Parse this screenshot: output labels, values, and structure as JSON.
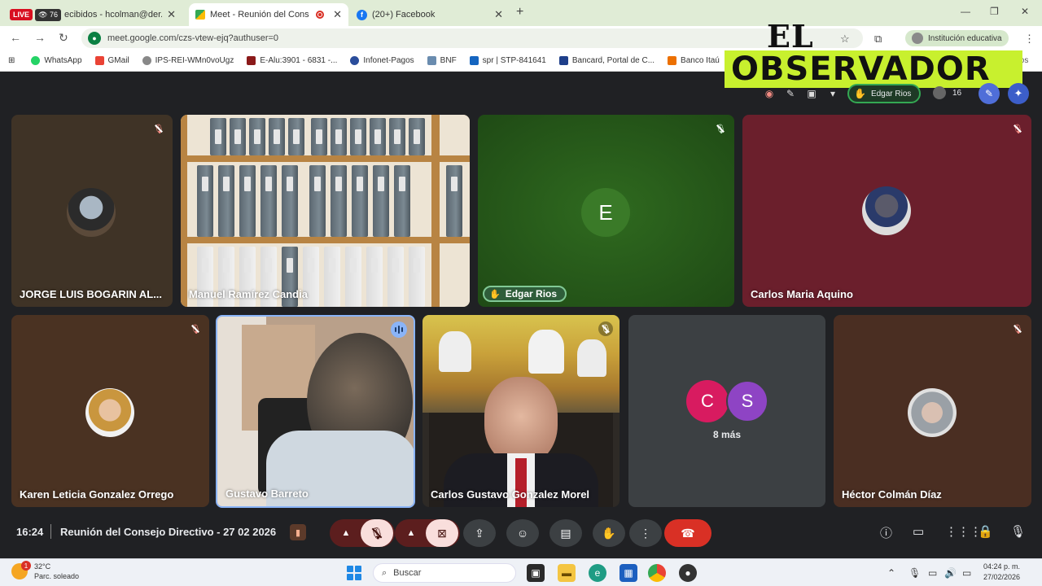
{
  "browser": {
    "tabs": [
      {
        "label": "ecibidos - hcolman@der.una.",
        "live_badge": "LIVE",
        "view_count": "76"
      },
      {
        "label": "Meet - Reunión del Consejo",
        "active": true
      },
      {
        "label": "(20+) Facebook"
      }
    ],
    "url": "meet.google.com/czs-vtew-ejq?authuser=0",
    "profile_label": "Institución educativa",
    "bookmarks": [
      "WhatsApp",
      "GMail",
      "IPS-REI-WMn0voUgz",
      "E-Alu:3901 - 6831 -...",
      "Infonet-Pagos",
      "BNF",
      "spr | STP-841641",
      "Bancard, Portal de C...",
      "Banco Itaú",
      "tos"
    ]
  },
  "logo": {
    "line1": "EL",
    "line2": "OBSERVADOR"
  },
  "meet_top": {
    "speaker_name": "Edgar Rios",
    "participant_count": "16"
  },
  "tiles": [
    {
      "name": "JORGE LUIS BOGARIN AL...",
      "muted": true
    },
    {
      "name": "Manuel Ramírez Candia",
      "muted": false
    },
    {
      "name": "Edgar Rios",
      "initial": "E",
      "muted": true,
      "hand_raised": true
    },
    {
      "name": "Carlos Maria Aquino",
      "muted": true
    },
    {
      "name": "Karen Leticia Gonzalez Orrego",
      "muted": true
    },
    {
      "name": "Gustavo Barreto",
      "muted": false,
      "speaking": true
    },
    {
      "name": "Carlos Gustavo Gonzalez Morel",
      "muted": true
    },
    {
      "more_initials": [
        "C",
        "S"
      ],
      "more_label": "8 más"
    },
    {
      "name": "Héctor Colmán Díaz",
      "muted": true
    }
  ],
  "bottom_bar": {
    "time": "16:24",
    "meeting_title": "Reunión del Consejo Directivo - 27 02 2026"
  },
  "taskbar": {
    "temperature": "32°C",
    "weather": "Parc. soleado",
    "weather_badge": "1",
    "search_placeholder": "Buscar",
    "time": "04:24 p. m.",
    "date": "27/02/2026"
  },
  "colors": {
    "meet_bg": "#202124",
    "hangup": "#d93025",
    "speaking_border": "#81c995",
    "logo_bg": "#c8f02e"
  }
}
